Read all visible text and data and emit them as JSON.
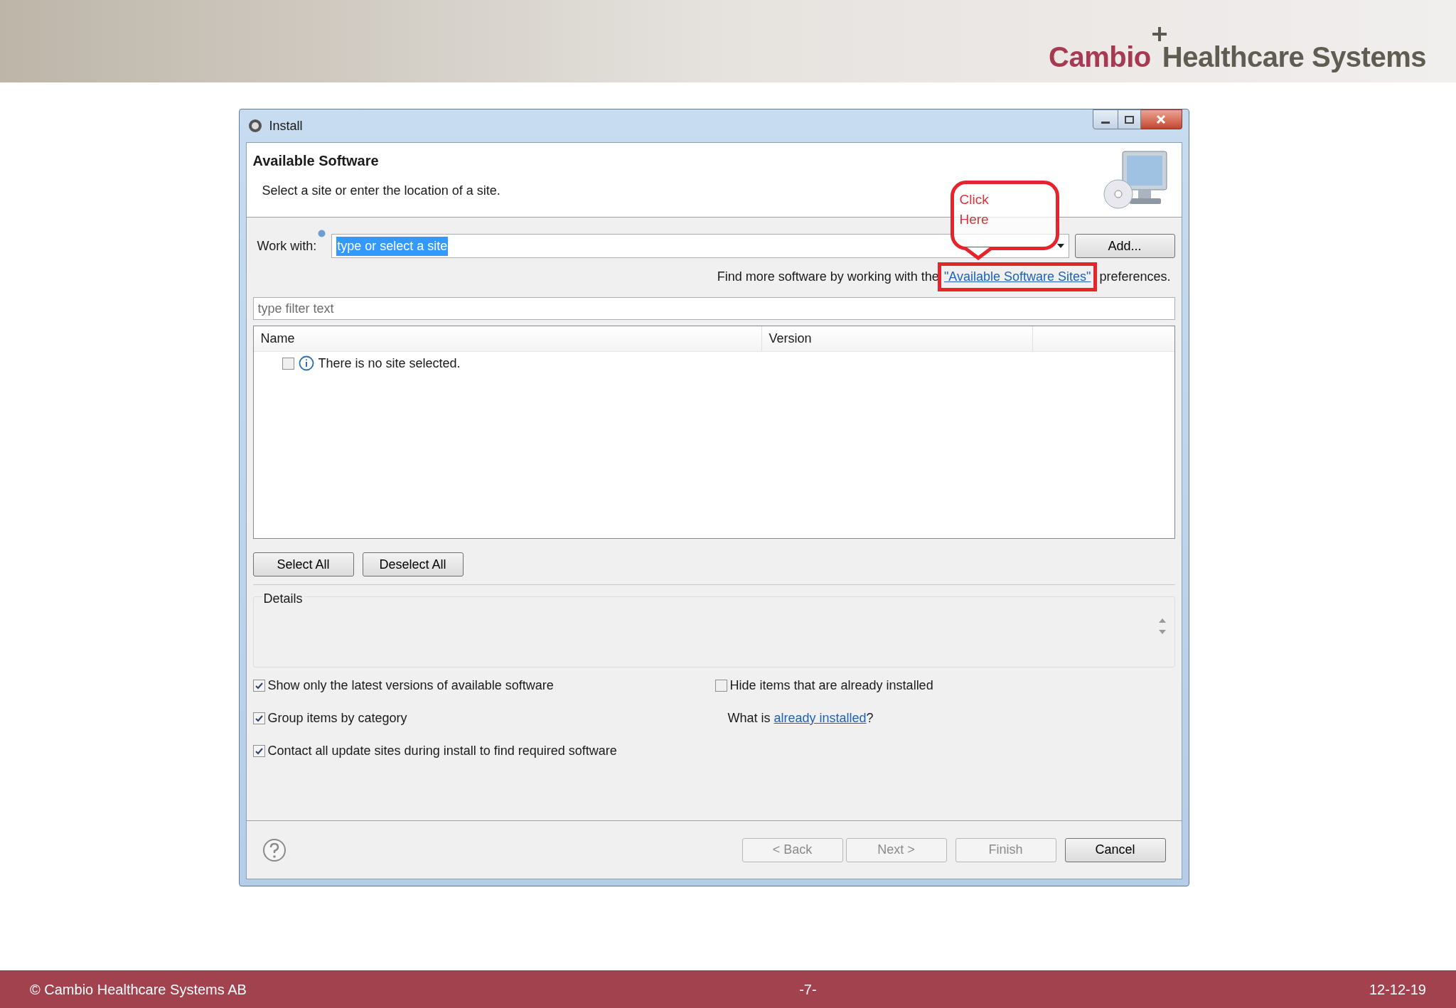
{
  "slide_header": {
    "logo": {
      "brand": "Cambio",
      "rest": "Healthcare Systems"
    }
  },
  "dialog": {
    "title": "Install",
    "heading": "Available Software",
    "subheading": "Select a site or enter the location of a site.",
    "work_with": {
      "label": "Work with:",
      "value": "type or select a site"
    },
    "add_button": "Add...",
    "more_software": {
      "before": "Find more software by working with the",
      "link": "\"Available Software Sites\"",
      "after": "preferences."
    },
    "callout": {
      "text": "Click Here"
    },
    "filter": {
      "placeholder": "type filter text"
    },
    "table": {
      "columns": [
        "Name",
        "Version"
      ],
      "rows": [
        {
          "checked": false,
          "text": "There is no site selected."
        }
      ]
    },
    "select_buttons": [
      "Select All",
      "Deselect All"
    ],
    "details": {
      "label": "Details"
    },
    "options_left": [
      {
        "label": "Show only the latest versions of available software",
        "checked": true
      },
      {
        "label": "Group items by category",
        "checked": true
      },
      {
        "label": "Contact all update sites during install to find required software",
        "checked": true
      }
    ],
    "options_right": {
      "checkbox": {
        "label": "Hide items that are already installed",
        "checked": false
      },
      "question": {
        "before": "What is",
        "link": "already installed",
        "after": "?"
      }
    },
    "footer_buttons": [
      {
        "label": "< Back",
        "disabled": true
      },
      {
        "label": "Next >",
        "disabled": true
      },
      {
        "label": "Finish",
        "disabled": true
      },
      {
        "label": "Cancel",
        "disabled": false
      }
    ]
  },
  "slide_footer": {
    "copyright": "© Cambio Healthcare Systems AB",
    "page": "-7-",
    "date": "12-12-19"
  }
}
